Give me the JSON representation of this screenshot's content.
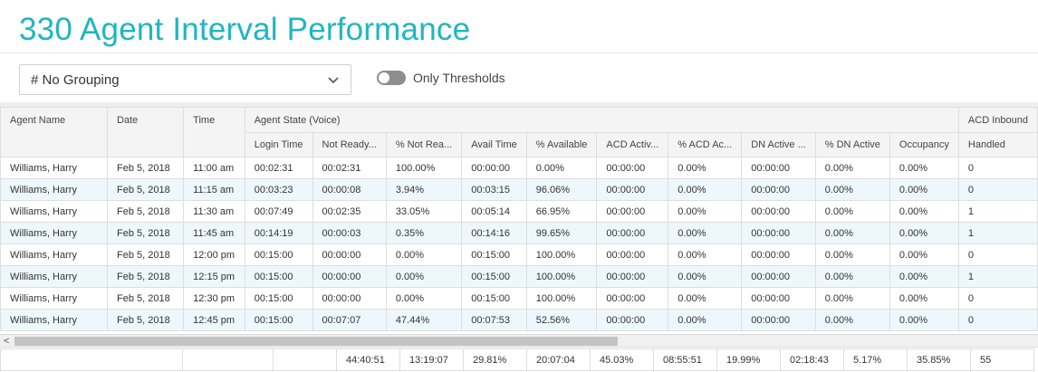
{
  "page_title": "330 Agent Interval Performance",
  "grouping": {
    "value": "# No Grouping"
  },
  "thresholds_toggle": {
    "label": "Only Thresholds",
    "on": false
  },
  "table": {
    "group_headers": {
      "agent_name": "Agent Name",
      "date": "Date",
      "time": "Time",
      "agent_state": "Agent State (Voice)",
      "acd_inbound": "ACD Inbound"
    },
    "sub_headers": [
      "Login Time",
      "Not Ready Time",
      "% Not Ready",
      "Avail Time",
      "% Available",
      "ACD Active Time",
      "% ACD Active",
      "DN Active Time",
      "% DN Active",
      "Occupancy",
      "Handled"
    ],
    "sub_headers_display": [
      "Login Time",
      "Not Ready...",
      "% Not Rea...",
      "Avail Time",
      "% Available",
      "ACD Activ...",
      "% ACD Ac...",
      "DN Active ...",
      "% DN Active",
      "Occupancy",
      "Handled"
    ],
    "rows": [
      [
        "Williams, Harry",
        "Feb 5, 2018",
        "11:00 am",
        "00:02:31",
        "00:02:31",
        "100.00%",
        "00:00:00",
        "0.00%",
        "00:00:00",
        "0.00%",
        "00:00:00",
        "0.00%",
        "0.00%",
        "0"
      ],
      [
        "Williams, Harry",
        "Feb 5, 2018",
        "11:15 am",
        "00:03:23",
        "00:00:08",
        "3.94%",
        "00:03:15",
        "96.06%",
        "00:00:00",
        "0.00%",
        "00:00:00",
        "0.00%",
        "0.00%",
        "0"
      ],
      [
        "Williams, Harry",
        "Feb 5, 2018",
        "11:30 am",
        "00:07:49",
        "00:02:35",
        "33.05%",
        "00:05:14",
        "66.95%",
        "00:00:00",
        "0.00%",
        "00:00:00",
        "0.00%",
        "0.00%",
        "1"
      ],
      [
        "Williams, Harry",
        "Feb 5, 2018",
        "11:45 am",
        "00:14:19",
        "00:00:03",
        "0.35%",
        "00:14:16",
        "99.65%",
        "00:00:00",
        "0.00%",
        "00:00:00",
        "0.00%",
        "0.00%",
        "1"
      ],
      [
        "Williams, Harry",
        "Feb 5, 2018",
        "12:00 pm",
        "00:15:00",
        "00:00:00",
        "0.00%",
        "00:15:00",
        "100.00%",
        "00:00:00",
        "0.00%",
        "00:00:00",
        "0.00%",
        "0.00%",
        "0"
      ],
      [
        "Williams, Harry",
        "Feb 5, 2018",
        "12:15 pm",
        "00:15:00",
        "00:00:00",
        "0.00%",
        "00:15:00",
        "100.00%",
        "00:00:00",
        "0.00%",
        "00:00:00",
        "0.00%",
        "0.00%",
        "1"
      ],
      [
        "Williams, Harry",
        "Feb 5, 2018",
        "12:30 pm",
        "00:15:00",
        "00:00:00",
        "0.00%",
        "00:15:00",
        "100.00%",
        "00:00:00",
        "0.00%",
        "00:00:00",
        "0.00%",
        "0.00%",
        "0"
      ],
      [
        "Williams, Harry",
        "Feb 5, 2018",
        "12:45 pm",
        "00:15:00",
        "00:07:07",
        "47.44%",
        "00:07:53",
        "52.56%",
        "00:00:00",
        "0.00%",
        "00:00:00",
        "0.00%",
        "0.00%",
        "0"
      ]
    ],
    "totals": [
      "",
      "",
      "",
      "44:40:51",
      "13:19:07",
      "29.81%",
      "20:07:04",
      "45.03%",
      "08:55:51",
      "19.99%",
      "02:18:43",
      "5.17%",
      "35.85%",
      "55"
    ]
  },
  "scrollbar": {
    "left_arrow": "<"
  },
  "icons": {
    "dropdown": "chevron-down-icon"
  },
  "colors": {
    "title": "#1fb6c1",
    "row_stripe": "#eef7fb",
    "header_bg": "#f4f4f4",
    "toggle_off": "#8e8e8e"
  }
}
